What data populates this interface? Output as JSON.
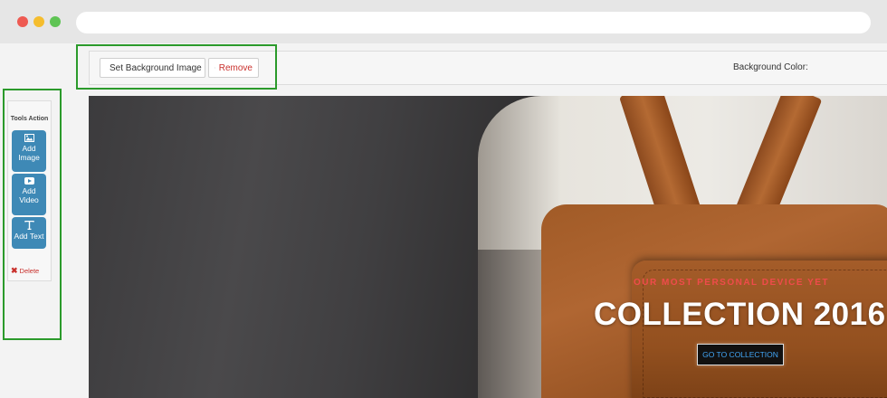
{
  "toolbar": {
    "set_background_label": "Set Background Image",
    "remove_label": "Remove",
    "background_color_label": "Background Color:"
  },
  "sidebar": {
    "title": "Tools Action",
    "add_image": "Add Image",
    "add_video": "Add Video",
    "add_text": "Add Text",
    "delete": "Delete"
  },
  "hero": {
    "tagline": "OUR MOST PERSONAL DEVICE YET",
    "headline": "COLLECTION 2016",
    "cta": "GO TO COLLECTION"
  },
  "colors": {
    "tool_button": "#3e89b6",
    "highlight_box": "#2b9a2b",
    "tagline": "#ef4b4b",
    "cta_text": "#42a5f5",
    "delete": "#c9302c"
  },
  "icons": [
    "upload-icon",
    "close-icon",
    "image-icon",
    "video-icon",
    "text-icon"
  ]
}
